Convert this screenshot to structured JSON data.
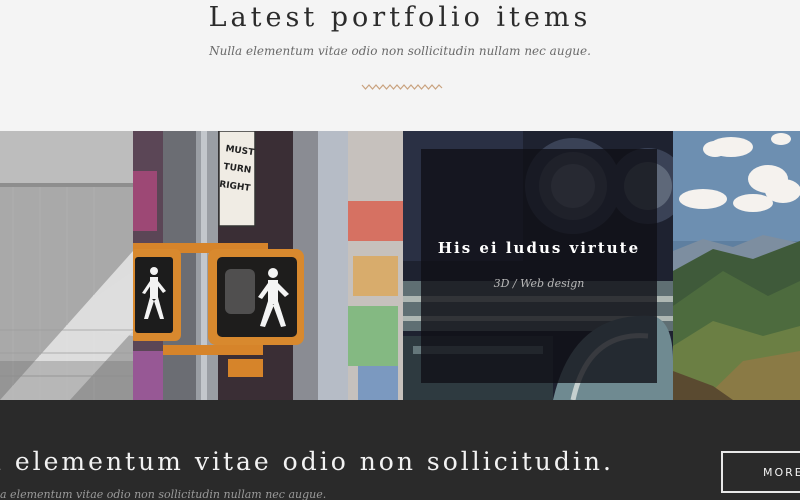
{
  "header": {
    "title": "Latest portfolio items",
    "subtitle": "Nulla elementum vitae odio non sollicitudin nullam nec augue.",
    "accent_color": "#c9a27e"
  },
  "gallery": {
    "items": [
      {
        "image": "architecture-photo"
      },
      {
        "image": "pedestrian-signal-photo",
        "sign_text": "MUST TURN RIGHT"
      },
      {
        "image": "vintage-car-photo",
        "title": "His ei ludus virtute",
        "categories": "3D / Web design"
      },
      {
        "image": "mountain-landscape-photo"
      }
    ]
  },
  "cta": {
    "heading": "a elementum vitae odio non sollicitudin.",
    "subtext": "a elementum vitae odio non sollicitudin nullam nec augue.",
    "button_label": "MORE"
  }
}
